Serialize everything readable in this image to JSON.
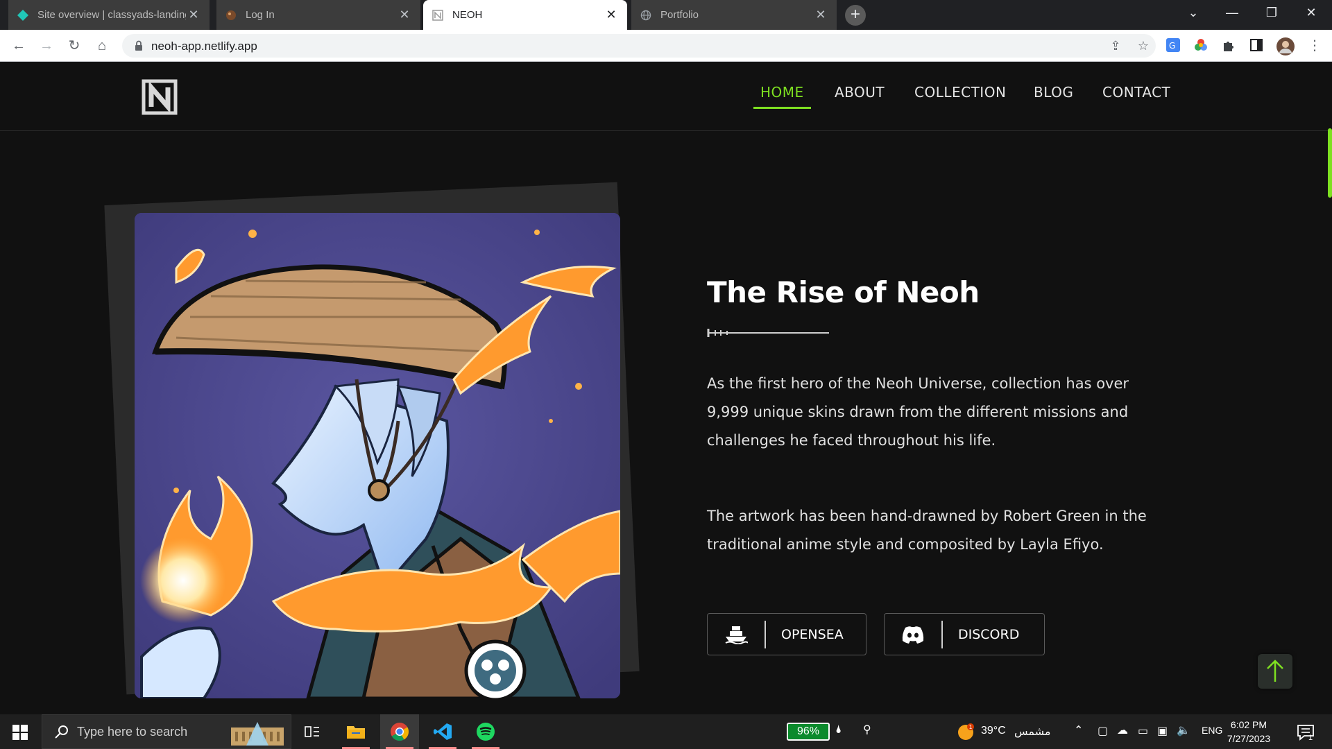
{
  "browser": {
    "tabs": [
      {
        "title": "Site overview | classyads-landing",
        "icon": "netlify-icon",
        "state": "inactive"
      },
      {
        "title": "Log In",
        "icon": "site-favicon",
        "state": "inactive"
      },
      {
        "title": "NEOH",
        "icon": "neoh-favicon",
        "state": "active"
      },
      {
        "title": "Portfolio",
        "icon": "globe-icon",
        "state": "inactive"
      }
    ],
    "url": "neoh-app.netlify.app"
  },
  "site": {
    "nav": [
      {
        "label": "HOME",
        "active": true
      },
      {
        "label": "ABOUT",
        "active": false
      },
      {
        "label": "COLLECTION",
        "active": false
      },
      {
        "label": "BLOG",
        "active": false
      },
      {
        "label": "CONTACT",
        "active": false
      }
    ],
    "accent_color": "#7ee021",
    "hero": {
      "title": "The Rise of Neoh",
      "paragraph1": "As the first hero of the Neoh Universe, collection has over 9,999 unique skins drawn from the different missions and challenges he faced throughout his life.",
      "paragraph2": "The artwork has been hand-drawned by Robert Green in the traditional anime style and composited by Layla Efiyo.",
      "buttons": [
        {
          "label": "OPENSEA",
          "icon": "ship-icon"
        },
        {
          "label": "DISCORD",
          "icon": "discord-icon"
        }
      ]
    }
  },
  "taskbar": {
    "search_placeholder": "Type here to search",
    "battery": "96%",
    "weather": "39°C",
    "weather_desc": "مشمس",
    "language": "ENG",
    "time": "6:02 PM",
    "date": "7/27/2023",
    "notification_count": "1"
  }
}
